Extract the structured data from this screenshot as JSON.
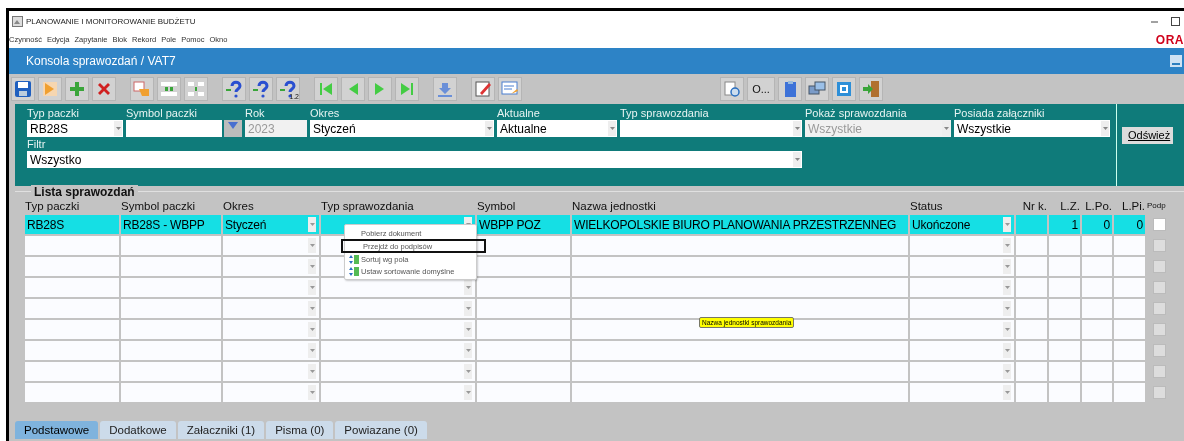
{
  "window": {
    "title": "PLANOWANIE I MONITOROWANIE BUDŻETU",
    "logo": "ORA"
  },
  "menu": [
    "Czynność",
    "Edycja",
    "Zapytanie",
    "Blok",
    "Rekord",
    "Pole",
    "Pomoc",
    "Okno"
  ],
  "form": {
    "title": "Konsola sprawozdań / VAT7"
  },
  "toolbar": {
    "text_button": "O...",
    "query_badge": "1.2"
  },
  "filters": [
    {
      "label": "Typ paczki",
      "value": "RB28S",
      "kind": "combo",
      "disabled": false
    },
    {
      "label": "Symbol paczki",
      "kind": "lov",
      "disabled": false
    },
    {
      "label": "Rok",
      "value": "2023",
      "kind": "text",
      "disabled": true
    },
    {
      "label": "Okres",
      "value": "Styczeń",
      "kind": "combo",
      "disabled": false
    },
    {
      "label": "Aktualne",
      "value": "Aktualne",
      "kind": "combo",
      "disabled": false
    },
    {
      "label": "Typ sprawozdania",
      "kind": "combo",
      "disabled": false
    },
    {
      "label": "Pokaż sprawozdania",
      "value": "Wszystkie",
      "kind": "combo",
      "disabled": true
    },
    {
      "label": "Posiada załączniki",
      "value": "Wszystkie",
      "kind": "combo",
      "disabled": false
    }
  ],
  "filter_row": {
    "label": "Filtr",
    "value": "Wszystko"
  },
  "refresh_button": "Odśwież",
  "list": {
    "title": "Lista sprawozdań",
    "columns": [
      {
        "label": "Typ paczki",
        "kind": "text"
      },
      {
        "label": "Symbol paczki",
        "kind": "text"
      },
      {
        "label": "Okres",
        "kind": "combo"
      },
      {
        "label": "Typ sprawozdania",
        "kind": "combo"
      },
      {
        "label": "Symbol",
        "kind": "text"
      },
      {
        "label": "Nazwa jednostki",
        "kind": "text"
      },
      {
        "label": "Status",
        "kind": "combo"
      },
      {
        "label": "Nr k.",
        "kind": "number"
      },
      {
        "label": "L.Z.",
        "kind": "number"
      },
      {
        "label": "L.Po.",
        "kind": "number"
      },
      {
        "label": "L.Pi.",
        "kind": "number"
      },
      {
        "label": "Podp",
        "kind": "check"
      }
    ],
    "rows": [
      {
        "selected": true,
        "disabled": false,
        "checked": false,
        "cells": [
          "RB28S",
          "RB28S - WBPP",
          "Styczeń",
          null,
          "WBPP POZ",
          "WIELKOPOLSKIE BIURO PLANOWANIA PRZESTRZENNEG",
          "Ukończone",
          null,
          "1",
          "0",
          "0"
        ]
      },
      {
        "selected": false,
        "disabled": true,
        "checked": false
      },
      {
        "selected": false,
        "disabled": true,
        "checked": false
      },
      {
        "selected": false,
        "disabled": true,
        "checked": false
      },
      {
        "selected": false,
        "disabled": true,
        "checked": false
      },
      {
        "selected": false,
        "disabled": true,
        "checked": false
      },
      {
        "selected": false,
        "disabled": true,
        "checked": false
      },
      {
        "selected": false,
        "disabled": true,
        "checked": false
      },
      {
        "selected": false,
        "disabled": true,
        "checked": false
      }
    ]
  },
  "context_menu": [
    {
      "label": "Pobierz dokument",
      "kind": "plain",
      "selected": false
    },
    {
      "label": "Przejdź do podpisów",
      "kind": "plain",
      "selected": true
    },
    {
      "label": "Sortuj wg pola",
      "kind": "sort",
      "selected": false
    },
    {
      "label": "Ustaw sortowanie domyślne",
      "kind": "sort",
      "selected": false
    }
  ],
  "tooltip": "Nazwa jednostki sprawozdania",
  "tabs": [
    {
      "label": "Podstawowe",
      "selected": true
    },
    {
      "label": "Dodatkowe",
      "selected": false
    },
    {
      "label": "Załaczniki (1)",
      "selected": false
    },
    {
      "label": "Pisma (0)",
      "selected": false
    },
    {
      "label": "Powiazane (0)",
      "selected": false
    }
  ]
}
